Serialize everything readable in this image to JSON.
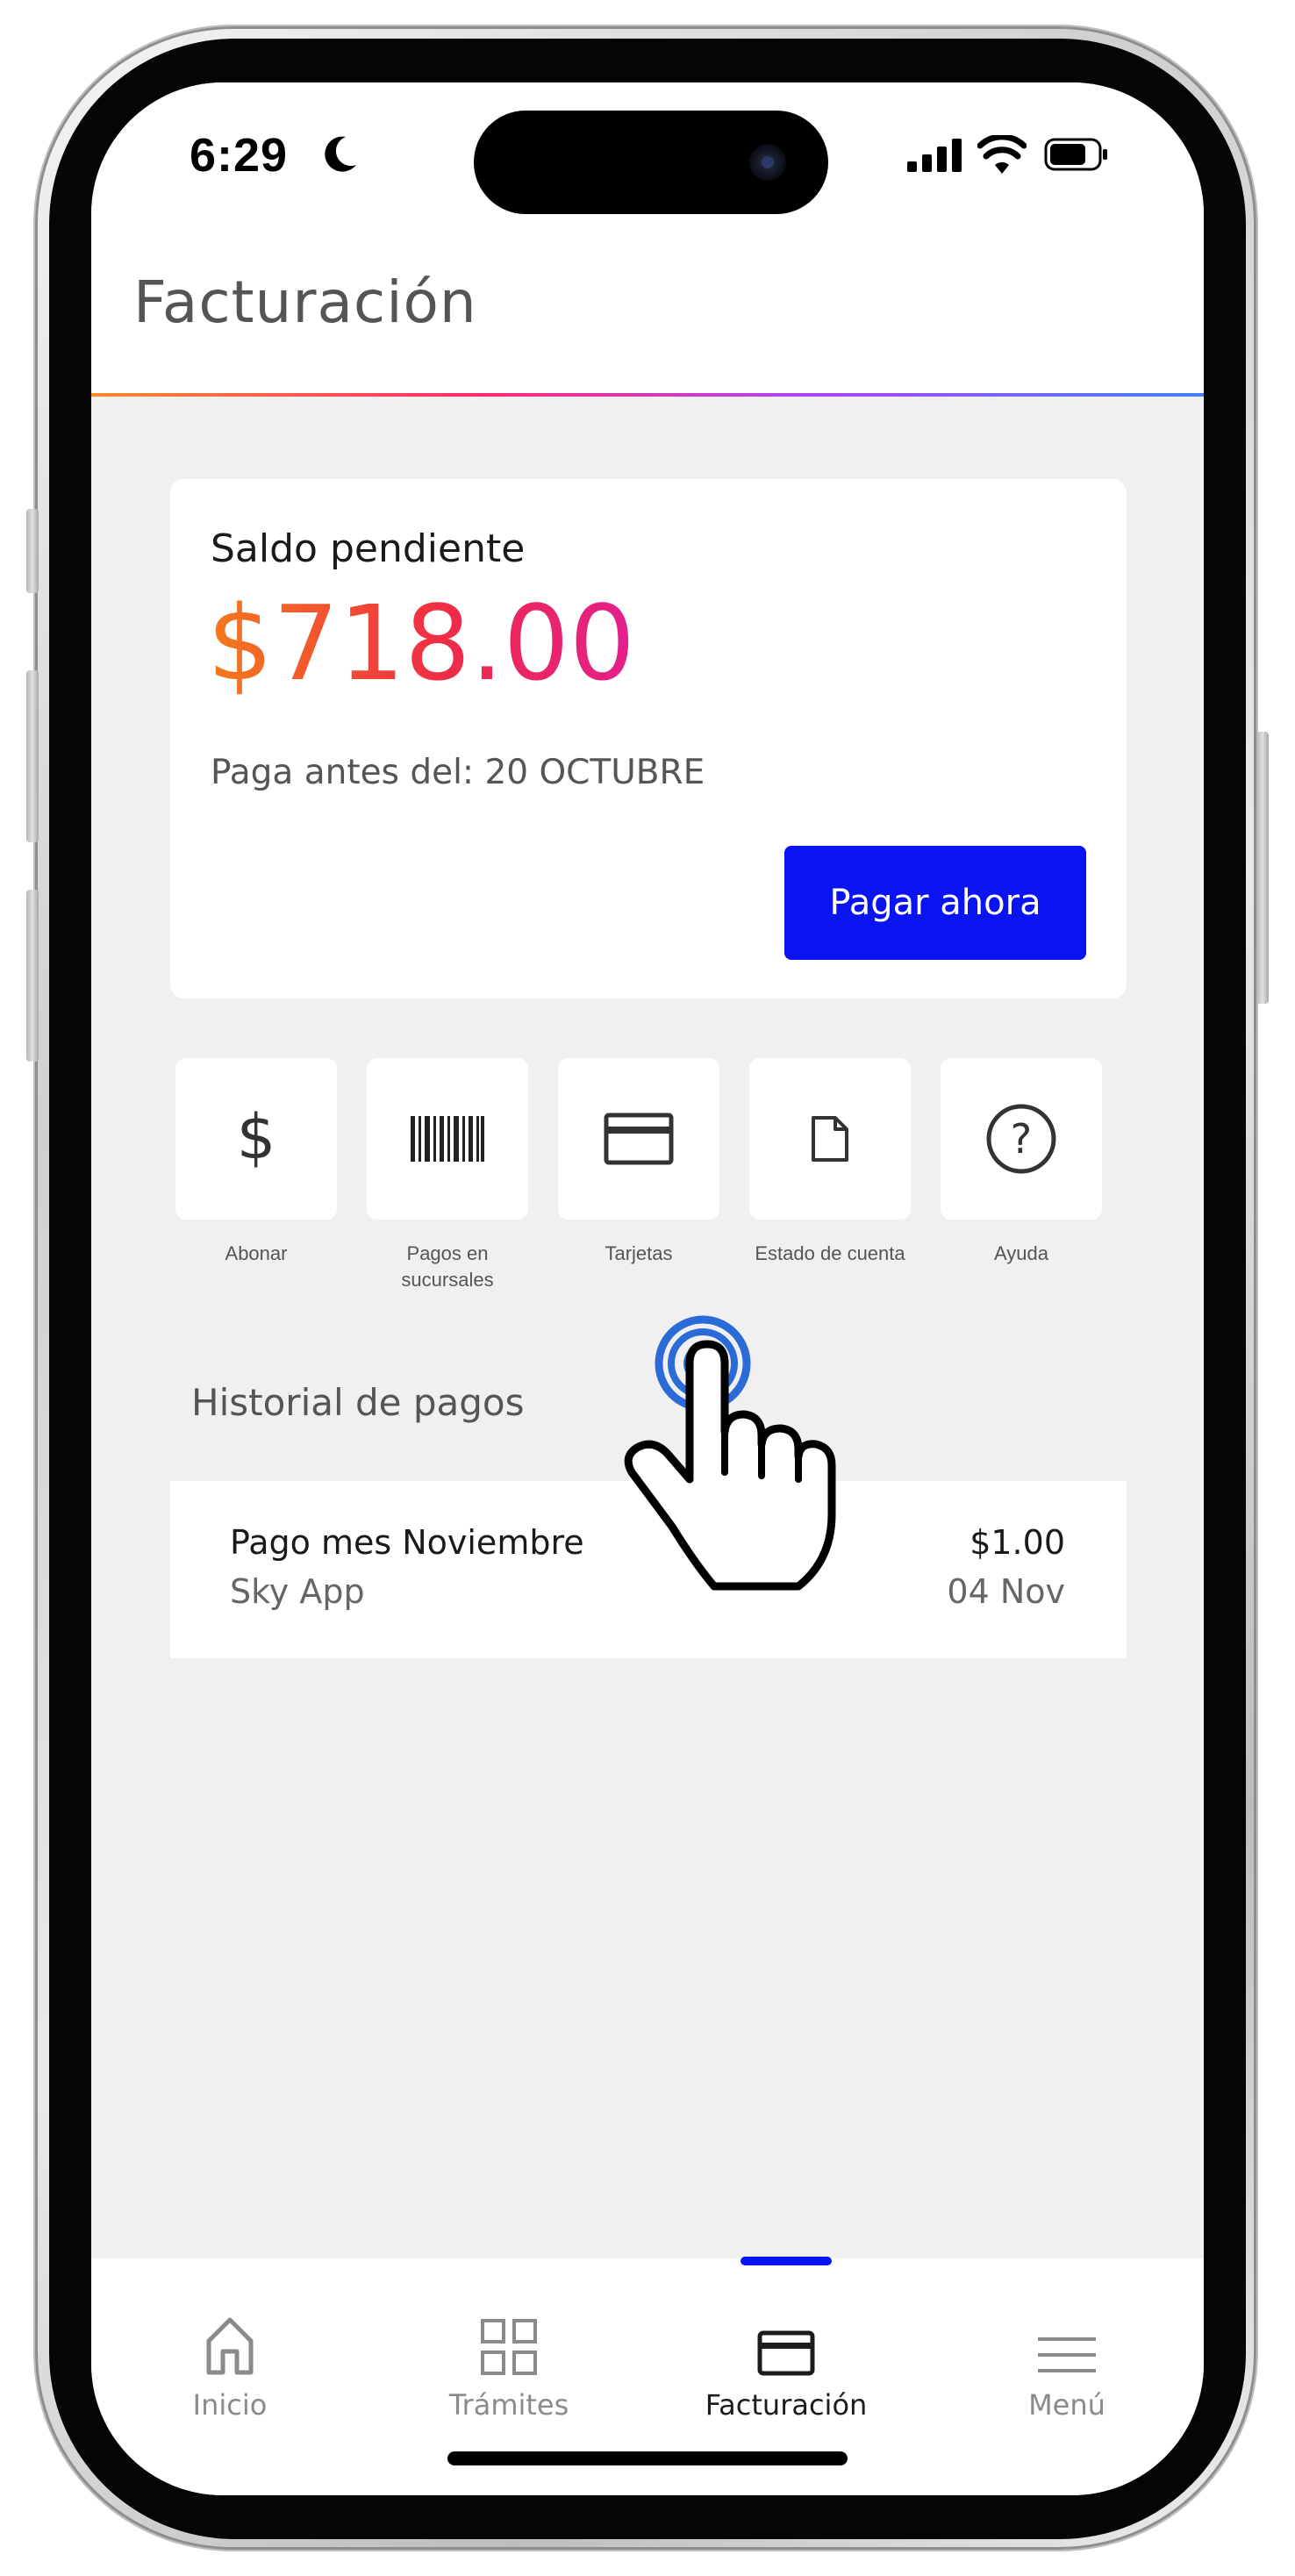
{
  "status_bar": {
    "time": "6:29"
  },
  "header": {
    "title": "Facturación"
  },
  "balance": {
    "label": "Saldo pendiente",
    "amount": "$718.00",
    "due": "Paga antes del: 20 OCTUBRE",
    "pay_button": "Pagar ahora"
  },
  "actions": [
    {
      "label": "Abonar",
      "icon": "dollar-icon"
    },
    {
      "label": "Pagos en sucursales",
      "icon": "barcode-icon"
    },
    {
      "label": "Tarjetas",
      "icon": "card-icon"
    },
    {
      "label": "Estado de cuenta",
      "icon": "document-icon"
    },
    {
      "label": "Ayuda",
      "icon": "help-icon"
    }
  ],
  "history": {
    "title": "Historial de pagos",
    "items": [
      {
        "concept": "Pago mes Noviembre",
        "source": "Sky App",
        "amount": "$1.00",
        "date": "04 Nov"
      }
    ]
  },
  "nav": {
    "items": [
      {
        "label": "Inicio",
        "icon": "home-icon"
      },
      {
        "label": "Trámites",
        "icon": "grid-icon"
      },
      {
        "label": "Facturación",
        "icon": "card-icon",
        "active": true
      },
      {
        "label": "Menú",
        "icon": "menu-icon"
      }
    ]
  },
  "colors": {
    "accent": "#0a14f0",
    "amount_gradient": [
      "#f57a1c",
      "#ef2c45",
      "#e41e8e"
    ],
    "background": "#f0f0f0"
  }
}
